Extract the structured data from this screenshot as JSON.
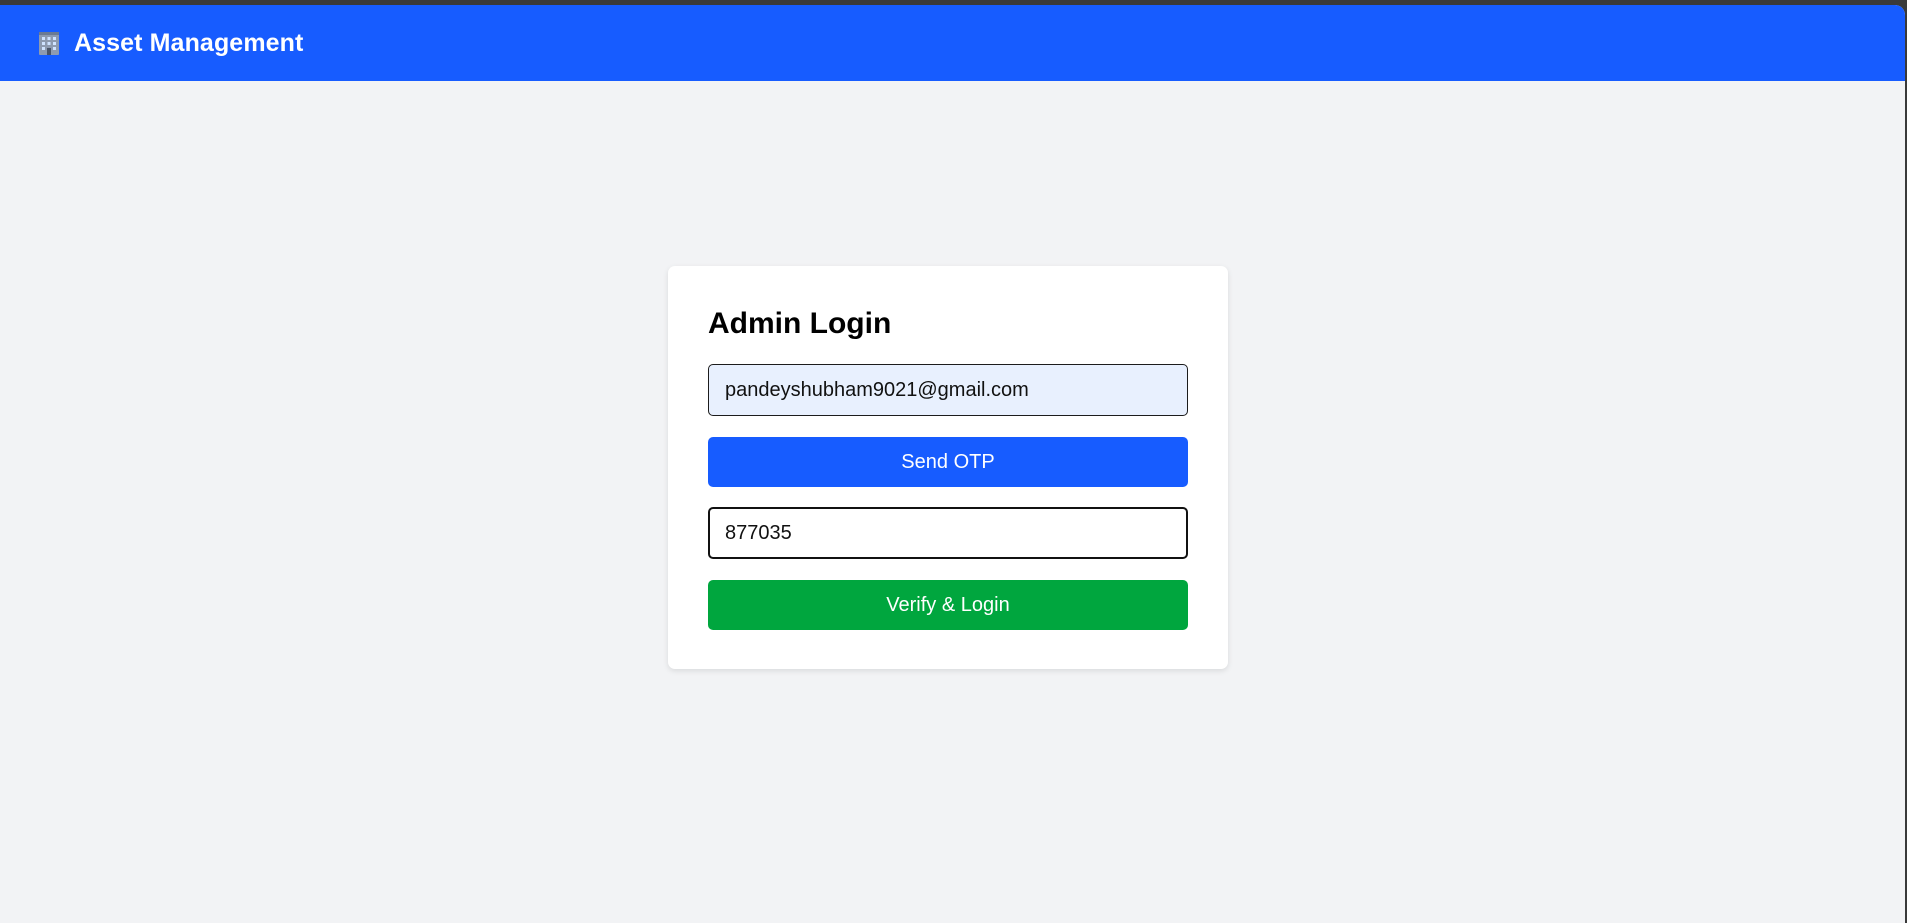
{
  "header": {
    "icon": "office-building-icon",
    "title": "Asset Management",
    "color": "#175cff"
  },
  "login": {
    "title": "Admin Login",
    "email_value": "pandeyshubham9021@gmail.com",
    "send_otp_label": "Send OTP",
    "otp_value": "877035",
    "verify_label": "Verify & Login",
    "send_color": "#175cff",
    "verify_color": "#00a63e"
  }
}
